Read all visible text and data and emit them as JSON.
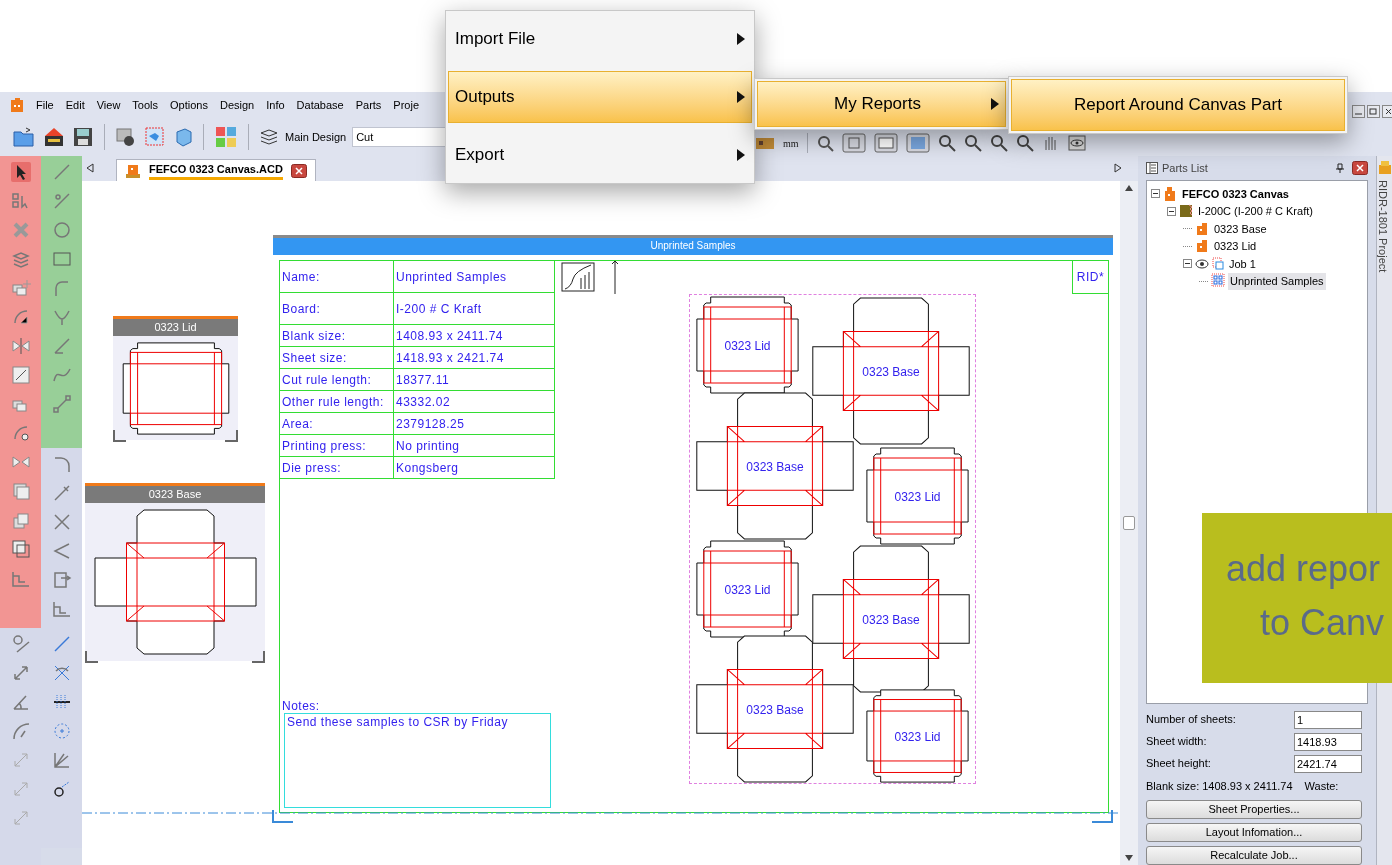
{
  "menu_bar": {
    "items": [
      "File",
      "Edit",
      "View",
      "Tools",
      "Options",
      "Design",
      "Info",
      "Database",
      "Parts",
      "Proje"
    ]
  },
  "toolbar": {
    "layer_label": "Main Design",
    "layer_value": "Cut",
    "unit": "mm"
  },
  "document_tab": {
    "title": "FEFCO 0323 Canvas.ACD",
    "selected": true
  },
  "popup_menu": {
    "items": [
      {
        "label": "Import File",
        "selected": false,
        "has_submenu": true
      },
      {
        "label": "Outputs",
        "selected": true,
        "has_submenu": true
      },
      {
        "label": "Export",
        "selected": false,
        "has_submenu": true
      }
    ],
    "submenu": [
      {
        "label": "My Reports",
        "selected": true,
        "has_submenu": true
      }
    ],
    "submenu_2": [
      {
        "label": "Report Around Canvas Part",
        "selected": true,
        "has_submenu": false
      }
    ]
  },
  "canvas": {
    "part_previews": [
      {
        "title": "0323 Lid",
        "kind": "lid"
      },
      {
        "title": "0323 Base",
        "kind": "base"
      }
    ],
    "report": {
      "title": "Unprinted Samples",
      "rows": [
        {
          "label": "Name:",
          "value": "Unprinted Samples"
        },
        {
          "label": "Board:",
          "value": "I-200 # C Kraft"
        },
        {
          "label": "Blank size:",
          "value": "1408.93 x 2411.74"
        },
        {
          "label": "Sheet size:",
          "value": "1418.93 x 2421.74"
        },
        {
          "label": "Cut rule length:",
          "value": "18377.11"
        },
        {
          "label": "Other rule length:",
          "value": "43332.02"
        },
        {
          "label": "Area:",
          "value": "2379128.25"
        },
        {
          "label": "Printing press:",
          "value": "No printing"
        },
        {
          "label": "Die press:",
          "value": "Kongsberg"
        }
      ],
      "rid": "RID*",
      "notes_label": "Notes:",
      "notes": "Send these samples to CSR by Friday",
      "layout": [
        {
          "label": "0323 Lid",
          "kind": "lid"
        },
        {
          "label": "0323 Base",
          "kind": "base"
        },
        {
          "label": "0323 Base",
          "kind": "base"
        },
        {
          "label": "0323 Lid",
          "kind": "lid"
        },
        {
          "label": "0323 Lid",
          "kind": "lid"
        },
        {
          "label": "0323 Base",
          "kind": "base"
        },
        {
          "label": "0323 Base",
          "kind": "base"
        },
        {
          "label": "0323 Lid",
          "kind": "lid"
        }
      ]
    }
  },
  "parts_list": {
    "title": "Parts List",
    "tree": [
      {
        "label": "FEFCO 0323 Canvas",
        "kind": "canvas",
        "expanded": true,
        "selected": false,
        "children": [
          {
            "label": "I-200C (I-200 # C Kraft)",
            "kind": "board",
            "expanded": true,
            "selected": false,
            "children": [
              {
                "label": "0323 Base",
                "kind": "part",
                "selected": false
              },
              {
                "label": "0323 Lid",
                "kind": "part",
                "selected": false
              },
              {
                "label": "Job 1",
                "kind": "job",
                "expanded": true,
                "selected": false,
                "children": [
                  {
                    "label": "Unprinted Samples",
                    "kind": "layout",
                    "selected": true
                  }
                ]
              }
            ]
          }
        ]
      }
    ],
    "fields": [
      {
        "label": "Number of sheets:",
        "value": "1"
      },
      {
        "label": "Sheet width:",
        "value": "1418.93"
      },
      {
        "label": "Sheet height:",
        "value": "2421.74"
      }
    ],
    "blank_size": "Blank size: 1408.93 x 2411.74",
    "waste": "Waste:",
    "buttons": [
      "Sheet Properties...",
      "Layout Infomation...",
      "Recalculate Job..."
    ]
  },
  "side_tab": "RIDR-1801 Project",
  "callout": [
    "add repor",
    "to Canv"
  ]
}
